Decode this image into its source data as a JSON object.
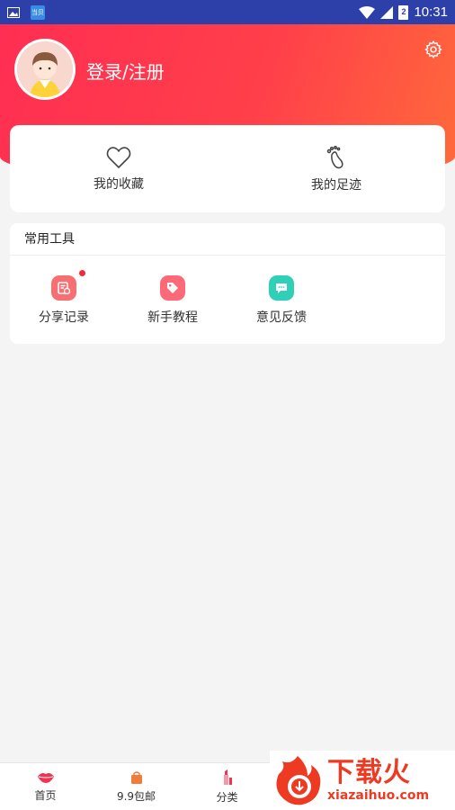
{
  "status_bar": {
    "time": "10:31",
    "battery": "2",
    "app_icon_text": "当贝"
  },
  "profile": {
    "login_label": "登录/注册"
  },
  "quick": [
    {
      "label": "我的收藏",
      "icon": "heart-icon"
    },
    {
      "label": "我的足迹",
      "icon": "footprint-icon"
    }
  ],
  "tools": {
    "title": "常用工具",
    "items": [
      {
        "label": "分享记录",
        "icon": "share-record-icon",
        "color": "#f76f72",
        "badge": true
      },
      {
        "label": "新手教程",
        "icon": "tag-icon",
        "color": "#fb6a76",
        "badge": false
      },
      {
        "label": "意见反馈",
        "icon": "feedback-icon",
        "color": "#2fcfb8",
        "badge": false
      }
    ]
  },
  "tabbar": [
    {
      "label": "首页",
      "icon": "lips-icon"
    },
    {
      "label": "9.9包邮",
      "icon": "bag-icon"
    },
    {
      "label": "分类",
      "icon": "lipstick-icon"
    }
  ],
  "watermark": {
    "cn": "下载火",
    "en": "xiazaihuo.com"
  },
  "colors": {
    "brand_red": "#ff2e52",
    "brand_orange": "#ff6a3b",
    "status_bar": "#2d3fa8"
  }
}
